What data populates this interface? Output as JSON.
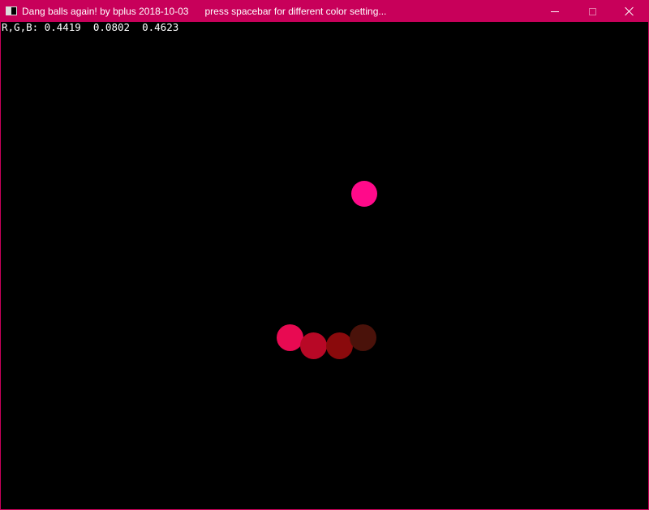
{
  "window": {
    "title": "Dang balls again! by bplus 2018-10-03      press spacebar for different color setting...",
    "accent_color": "#c8005a",
    "icons": {
      "app": "app-icon",
      "minimize": "minimize-icon",
      "maximize": "maximize-icon",
      "close": "close-icon"
    }
  },
  "canvas": {
    "background": "#000000",
    "rgb_readout": "R,G,B: 0.4419  0.0802  0.4623"
  },
  "balls": [
    {
      "name": "ball-pink",
      "color": "#ff0a8a"
    },
    {
      "name": "ball-red-1",
      "color": "#e80a52"
    },
    {
      "name": "ball-red-2",
      "color": "#b80826"
    },
    {
      "name": "ball-red-3",
      "color": "#8a0a0c"
    },
    {
      "name": "ball-dark",
      "color": "#4a120a"
    }
  ]
}
